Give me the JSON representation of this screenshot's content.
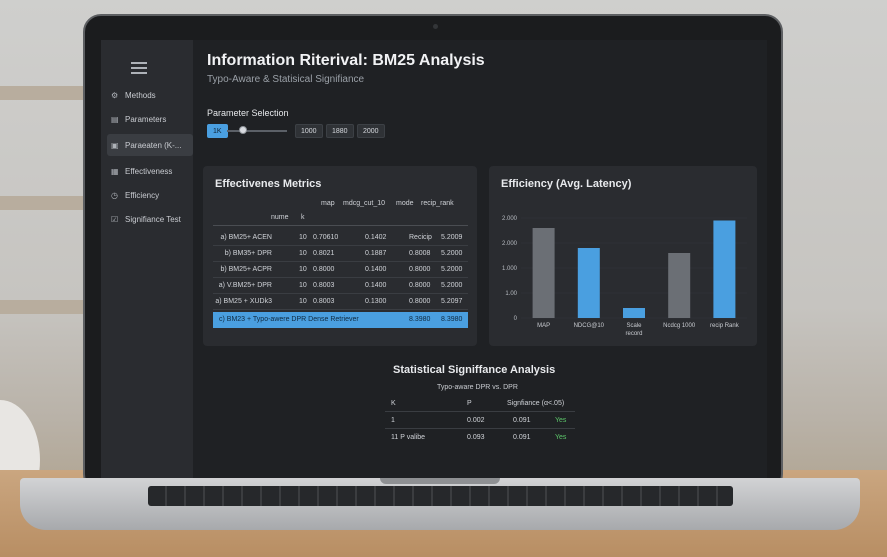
{
  "app": {
    "title": "Information Riterival: BM25 Analysis",
    "subtitle": "Typo-Aware & Statisical Signifiance"
  },
  "sidebar": {
    "items": [
      {
        "label": "Methods",
        "icon": "gear-icon"
      },
      {
        "label": "Parameters",
        "icon": "sliders-icon"
      },
      {
        "label": "Paraeaten (K-...",
        "icon": "document-icon",
        "active": true
      },
      {
        "label": "Effectiveness",
        "icon": "chart-icon"
      },
      {
        "label": "Efficiency",
        "icon": "clock-icon"
      },
      {
        "label": "Signifiance Test",
        "icon": "check-icon"
      }
    ]
  },
  "params": {
    "label": "Parameter Selection",
    "chips": [
      "1K",
      "1000",
      "1880",
      "2000"
    ],
    "selected_index": 0
  },
  "metrics": {
    "title": "Effectivenes Metrics",
    "columns": [
      "map",
      "mdcg_cut_10",
      "mode",
      "recip_rank"
    ],
    "subheader": [
      "nume",
      "k"
    ],
    "rows": [
      {
        "name": "a) BM25+ ACEN",
        "k": "10",
        "c1": "0.70610",
        "c2": "0.1402",
        "c3": "Recicip",
        "c4": "5.2009"
      },
      {
        "name": "b) BM35+ DPR",
        "k": "10",
        "c1": "0.8021",
        "c2": "0.1887",
        "c3": "0.8008",
        "c4": "5.2000"
      },
      {
        "name": "b) BM25+ ACPR",
        "k": "10",
        "c1": "0.8000",
        "c2": "0.1400",
        "c3": "0.8000",
        "c4": "5.2000"
      },
      {
        "name": "a) V.BM25+ DPR",
        "k": "10",
        "c1": "0.8003",
        "c2": "0.1400",
        "c3": "0.8000",
        "c4": "5.2000"
      },
      {
        "name": "a) BM25 + XUDk3",
        "k": "10",
        "c1": "0.8003",
        "c2": "0.1300",
        "c3": "0.8000",
        "c4": "5.2097"
      }
    ],
    "highlight": {
      "name": "c) BM23 + Typo-awere DPR Dense Retriever",
      "c3": "8.3980",
      "c4": "8.3980"
    }
  },
  "efficiency": {
    "title": "Efficiency (Avg. Latency)"
  },
  "significance": {
    "title": "Statistical Signiffance Analysis",
    "subtitle": "Typo-aware DPR vs. DPR",
    "columns": [
      "K",
      "P",
      "Signfiance (α<.05)"
    ],
    "rows": [
      {
        "k": "1",
        "a": "0.002",
        "b": "0.091",
        "sig": "Yes"
      },
      {
        "k": "11  P valibe",
        "a": "0.093",
        "b": "0.091",
        "sig": "Yes"
      }
    ]
  },
  "chart_data": {
    "type": "bar",
    "title": "Efficiency (Avg. Latency)",
    "categories": [
      "MAP",
      "NDCG@10",
      "Scale record",
      "Ncdcg 1000",
      "recip Rank"
    ],
    "values": [
      1800,
      1400,
      200,
      1300,
      1950
    ],
    "colors": [
      "#6b6f75",
      "#4a9fe0",
      "#4a9fe0",
      "#6b6f75",
      "#4a9fe0"
    ],
    "yticks": [
      "2.000",
      "2.000",
      "1.000",
      "1.00",
      "0"
    ],
    "ylim": [
      0,
      2000
    ]
  }
}
